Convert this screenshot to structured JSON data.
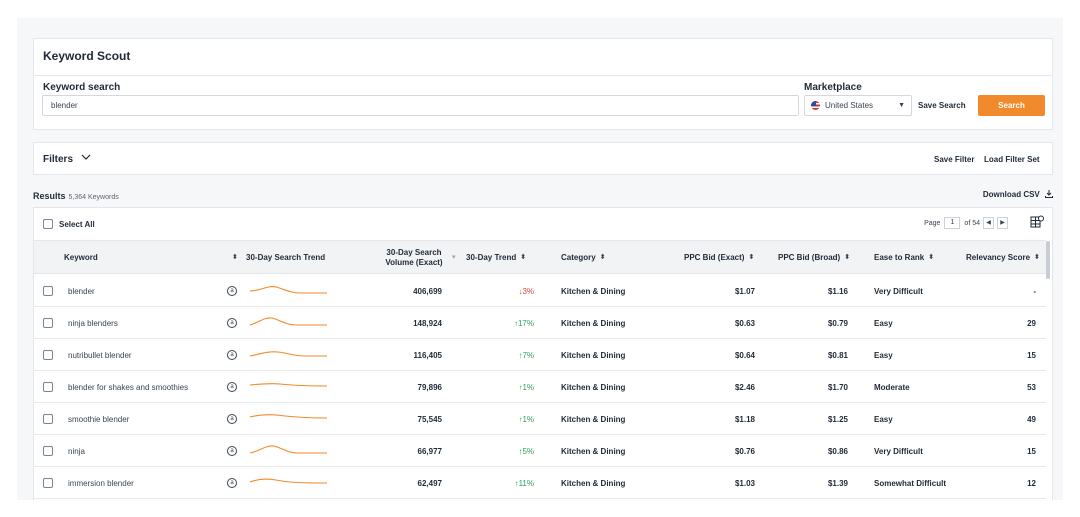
{
  "search": {
    "title": "Keyword Scout",
    "keyword_label": "Keyword search",
    "keyword_value": "blender",
    "marketplace_label": "Marketplace",
    "marketplace_value": "United States",
    "save_search": "Save Search",
    "search_button": "Search"
  },
  "filters": {
    "label": "Filters",
    "save_filter": "Save Filter",
    "load_filter_set": "Load Filter Set"
  },
  "results": {
    "label": "Results",
    "count": "5,364 Keywords",
    "download": "Download CSV",
    "select_all": "Select All",
    "page_label": "Page",
    "page_current": "1",
    "page_total": "of 54"
  },
  "columns": {
    "keyword": "Keyword",
    "search_trend": "30-Day Search Trend",
    "volume": "30-Day Search Volume (Exact)",
    "trend": "30-Day Trend",
    "category": "Category",
    "ppc_exact": "PPC Bid (Exact)",
    "ppc_broad": "PPC Bid (Broad)",
    "ease": "Ease to Rank",
    "relevancy": "Relevancy Score"
  },
  "rows": [
    {
      "keyword": "blender",
      "volume": "406,699",
      "trend": "3%",
      "trend_dir": "down",
      "category": "Kitchen & Dining",
      "ppc_exact": "$1.07",
      "ppc_broad": "$1.16",
      "ease": "Very Difficult",
      "relevancy": "-"
    },
    {
      "keyword": "ninja blenders",
      "volume": "148,924",
      "trend": "17%",
      "trend_dir": "up",
      "category": "Kitchen & Dining",
      "ppc_exact": "$0.63",
      "ppc_broad": "$0.79",
      "ease": "Easy",
      "relevancy": "29"
    },
    {
      "keyword": "nutribullet blender",
      "volume": "116,405",
      "trend": "7%",
      "trend_dir": "up",
      "category": "Kitchen & Dining",
      "ppc_exact": "$0.64",
      "ppc_broad": "$0.81",
      "ease": "Easy",
      "relevancy": "15"
    },
    {
      "keyword": "blender for shakes and smoothies",
      "volume": "79,896",
      "trend": "1%",
      "trend_dir": "up",
      "category": "Kitchen & Dining",
      "ppc_exact": "$2.46",
      "ppc_broad": "$1.70",
      "ease": "Moderate",
      "relevancy": "53"
    },
    {
      "keyword": "smoothie blender",
      "volume": "75,545",
      "trend": "1%",
      "trend_dir": "up",
      "category": "Kitchen & Dining",
      "ppc_exact": "$1.18",
      "ppc_broad": "$1.25",
      "ease": "Easy",
      "relevancy": "49"
    },
    {
      "keyword": "ninja",
      "volume": "66,977",
      "trend": "5%",
      "trend_dir": "up",
      "category": "Kitchen & Dining",
      "ppc_exact": "$0.76",
      "ppc_broad": "$0.86",
      "ease": "Very Difficult",
      "relevancy": "15"
    },
    {
      "keyword": "immersion blender",
      "volume": "62,497",
      "trend": "11%",
      "trend_dir": "up",
      "category": "Kitchen & Dining",
      "ppc_exact": "$1.03",
      "ppc_broad": "$1.39",
      "ease": "Somewhat Difficult",
      "relevancy": "12"
    }
  ],
  "colors": {
    "accent": "#f08a2c",
    "trend_up": "#2f9e62",
    "trend_down": "#d64a3a"
  }
}
